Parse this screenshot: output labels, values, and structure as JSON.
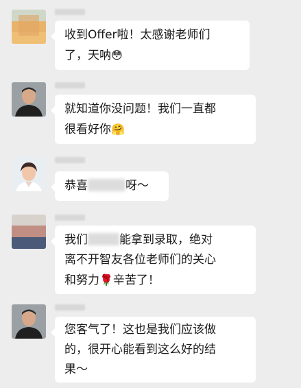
{
  "conversation": {
    "messages": [
      {
        "avatar": "blurred-avatar",
        "lines": [
          "收到Offer啦！太感谢老师们",
          "了，天呐"
        ],
        "emoji": "😳"
      },
      {
        "avatar": "teacher-man-avatar",
        "lines": [
          "就知道你没问题！我们一直都",
          "很看好你"
        ],
        "emoji": "🤗"
      },
      {
        "avatar": "teacher-woman-avatar",
        "prefix": "恭喜",
        "suffix": "呀～"
      },
      {
        "avatar": "blurred-avatar",
        "line1_prefix": "我们",
        "line1_suffix": "能拿到录取，绝对",
        "line2": "离不开智友各位老师们的关心",
        "line3_prefix": "和努力",
        "line3_emoji": "🌹",
        "line3_suffix": "辛苦了！"
      },
      {
        "avatar": "teacher-man-avatar",
        "lines": [
          "您客气了！这也是我们应该做",
          "的，很开心能看到这么好的结",
          "果～"
        ]
      }
    ]
  }
}
